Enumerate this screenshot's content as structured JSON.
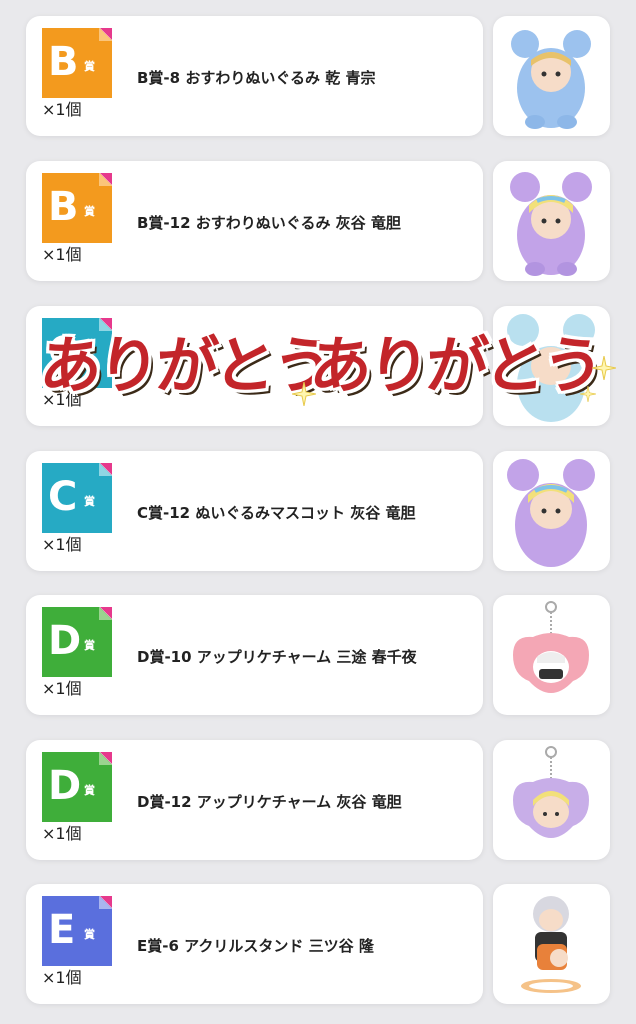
{
  "items": [
    {
      "badge_letter": "B",
      "badge_suffix": "賞",
      "badge_color": "#f39a1e",
      "quantity": "×1個",
      "name": "B賞-8 おすわりぬいぐるみ 乾 青宗",
      "thumb_color": "#9cc2ee"
    },
    {
      "badge_letter": "B",
      "badge_suffix": "賞",
      "badge_color": "#f39a1e",
      "quantity": "×1個",
      "name": "B賞-12 おすわりぬいぐるみ 灰谷 竜胆",
      "thumb_color": "#c2a3e8"
    },
    {
      "badge_letter": "C",
      "badge_suffix": "賞",
      "badge_color": "#26aac4",
      "quantity": "×1個",
      "name": "",
      "thumb_color": "#b9e0ef"
    },
    {
      "badge_letter": "C",
      "badge_suffix": "賞",
      "badge_color": "#26aac4",
      "quantity": "×1個",
      "name": "C賞-12 ぬいぐるみマスコット 灰谷 竜胆",
      "thumb_color": "#c2a3e8"
    },
    {
      "badge_letter": "D",
      "badge_suffix": "賞",
      "badge_color": "#3fae3a",
      "quantity": "×1個",
      "name": "D賞-10 アップリケチャーム 三途 春千夜",
      "thumb_color": "#f4a7b5"
    },
    {
      "badge_letter": "D",
      "badge_suffix": "賞",
      "badge_color": "#3fae3a",
      "quantity": "×1個",
      "name": "D賞-12 アップリケチャーム 灰谷 竜胆",
      "thumb_color": "#c8aee8"
    },
    {
      "badge_letter": "E",
      "badge_suffix": "賞",
      "badge_color": "#5a6fdd",
      "quantity": "×1個",
      "name": "E賞-6 アクリルスタンド 三ツ谷 隆",
      "thumb_color": "#e8813a"
    }
  ],
  "overlay": {
    "text_left": "ありがとう",
    "text_right": "ありがとう",
    "color": "#c3252a"
  }
}
